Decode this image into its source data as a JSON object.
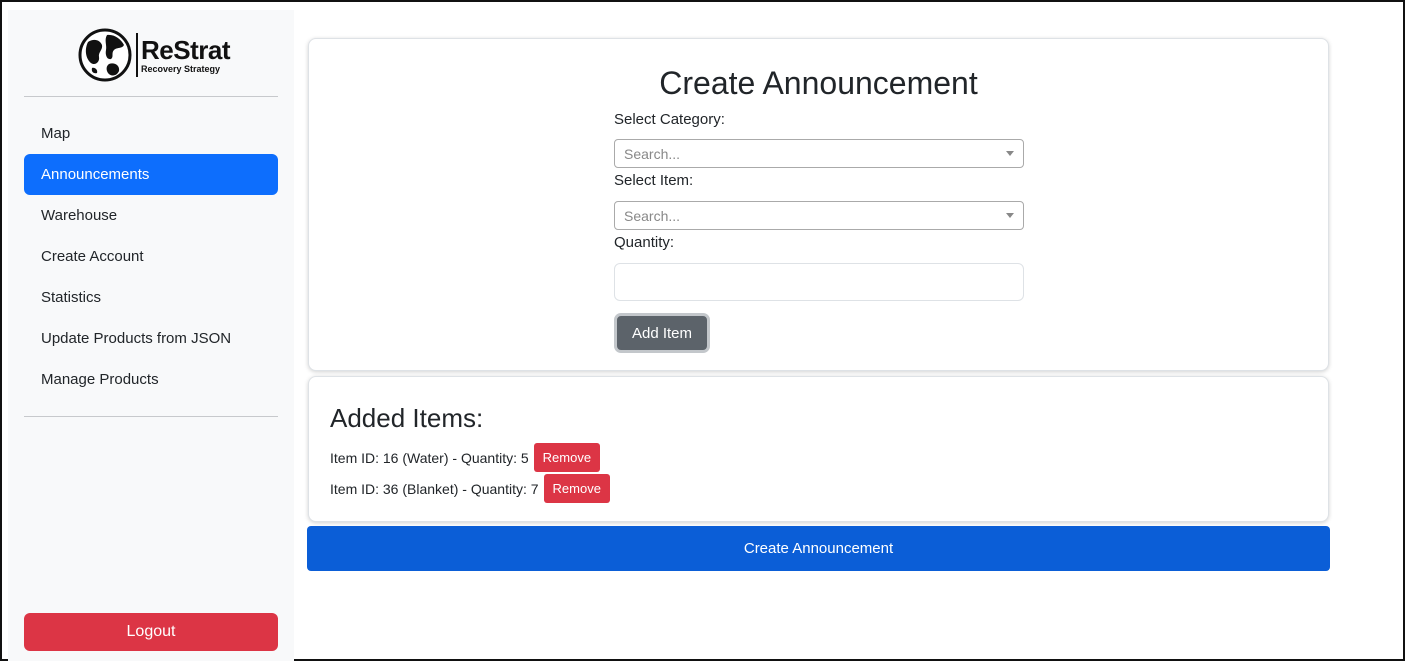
{
  "brand": {
    "name": "ReStrat",
    "tagline": "Recovery Strategy"
  },
  "sidebar": {
    "items": [
      {
        "label": "Map",
        "active": false
      },
      {
        "label": "Announcements",
        "active": true
      },
      {
        "label": "Warehouse",
        "active": false
      },
      {
        "label": "Create Account",
        "active": false
      },
      {
        "label": "Statistics",
        "active": false
      },
      {
        "label": "Update Products from JSON",
        "active": false
      },
      {
        "label": "Manage Products",
        "active": false
      }
    ],
    "logout_label": "Logout"
  },
  "form": {
    "title": "Create Announcement",
    "category_label": "Select Category:",
    "category_placeholder": "Search...",
    "item_label": "Select Item:",
    "item_placeholder": "Search...",
    "quantity_label": "Quantity:",
    "quantity_value": "",
    "add_button": "Add Item"
  },
  "added": {
    "title": "Added Items:",
    "items": [
      {
        "text": "Item ID: 16 (Water) - Quantity: 5",
        "remove_label": "Remove"
      },
      {
        "text": "Item ID: 36 (Blanket) - Quantity: 7",
        "remove_label": "Remove"
      }
    ]
  },
  "submit_label": "Create Announcement",
  "colors": {
    "primary": "#0d6efd",
    "danger": "#dc3545",
    "secondary": "#5c636a",
    "sidebar_bg": "#f8f9fa"
  },
  "icons": [
    "globe-icon",
    "dropdown-caret-icon"
  ]
}
